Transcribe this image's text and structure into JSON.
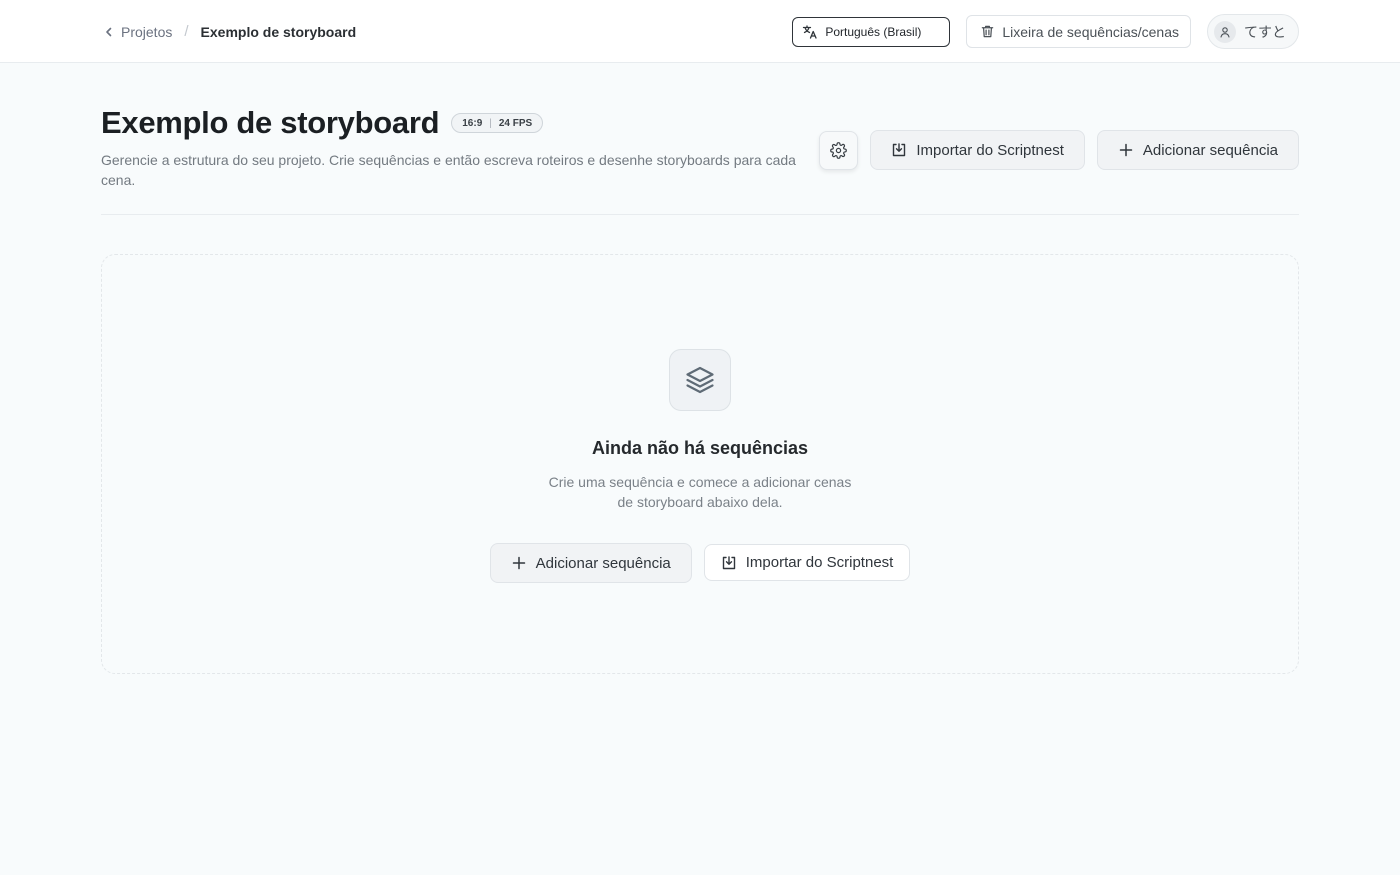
{
  "breadcrumb": {
    "back_label": "Projetos",
    "separator": "/",
    "current": "Exemplo de storyboard"
  },
  "topbar": {
    "language_label": "Português (Brasil)",
    "trash_label": "Lixeira de sequências/cenas",
    "user_name": "てすと"
  },
  "header": {
    "title": "Exemplo de storyboard",
    "aspect_ratio": "16:9",
    "fps": "24 FPS",
    "description": "Gerencie a estrutura do seu projeto. Crie sequências e então escreva roteiros e desenhe storyboards para cada cena.",
    "import_label": "Importar do Scriptnest",
    "add_label": "Adicionar sequência"
  },
  "empty_state": {
    "title": "Ainda não há sequências",
    "description": "Crie uma sequência e comece a adicionar cenas de storyboard abaixo dela.",
    "add_label": "Adicionar sequência",
    "import_label": "Importar do Scriptnest"
  },
  "icons": {
    "back": "chevron-left-icon",
    "language": "translate-icon",
    "trash": "trash-icon",
    "user": "user-icon",
    "settings": "gear-icon",
    "import": "import-icon",
    "add": "plus-icon",
    "layers": "layers-icon"
  }
}
